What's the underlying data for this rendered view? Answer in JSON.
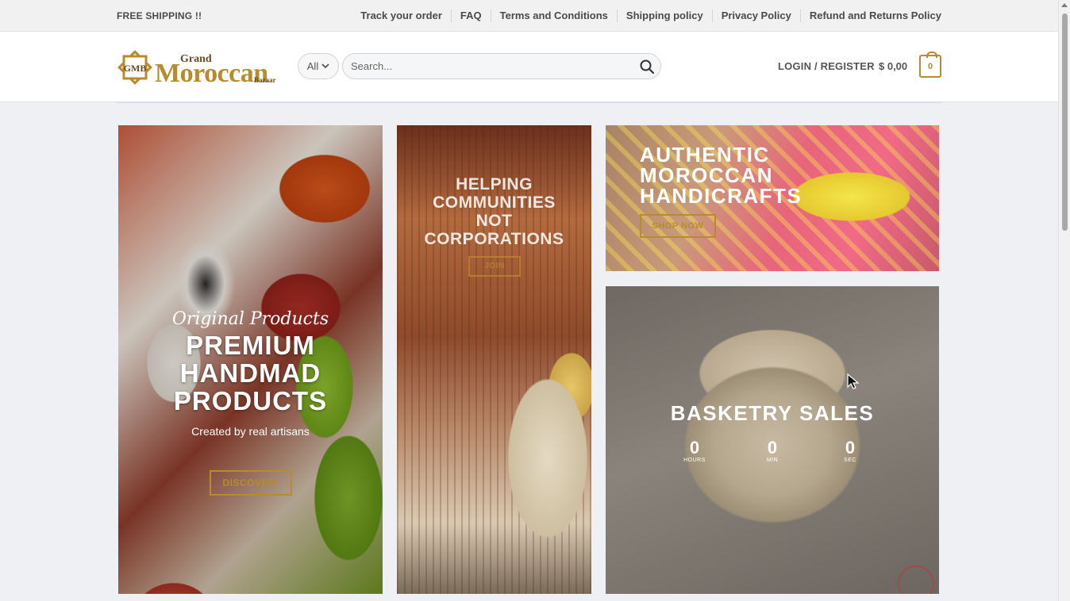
{
  "topbar": {
    "shipping": "FREE SHIPPING !!",
    "links": [
      "Track your order",
      "FAQ",
      "Terms and Conditions",
      "Shipping policy",
      "Privacy Policy",
      "Refund and Returns Policy"
    ]
  },
  "header": {
    "logo": {
      "monogram": "GMB",
      "grand": "Grand",
      "moroccan": "Moroccan",
      "bazaar": "Bazaar"
    },
    "search": {
      "category": "All",
      "placeholder": "Search..."
    },
    "account": "LOGIN / REGISTER",
    "cart_total": "$ 0,00",
    "cart_count": "0"
  },
  "banners": {
    "premium": {
      "script": "Original Products",
      "title_lines": [
        "PREMIUM",
        "HANDMAD",
        "PRODUCTS"
      ],
      "subtitle": "Created by real artisans",
      "button": "DISCOVER!"
    },
    "communities": {
      "title_lines": [
        "HELPING",
        "COMMUNITIES",
        "NOT",
        "CORPORATIONS"
      ],
      "button": "JOIN"
    },
    "authentic": {
      "title_lines": [
        "AUTHENTIC",
        "MOROCCAN",
        "HANDICRAFTS"
      ],
      "button": "SHOP NOW"
    },
    "basketry": {
      "title": "BASKETRY SALES",
      "countdown": [
        {
          "value": "0",
          "label": "HOURS"
        },
        {
          "value": "0",
          "label": "MIN"
        },
        {
          "value": "0",
          "label": "SEC"
        }
      ]
    }
  },
  "colors": {
    "accent": "#b98a2e",
    "topbar_bg": "#f1f1f1",
    "page_bg": "#eef0f3"
  },
  "icons": {
    "search": "search-icon",
    "select": "chevron-down-icon",
    "cart": "cart-icon"
  }
}
